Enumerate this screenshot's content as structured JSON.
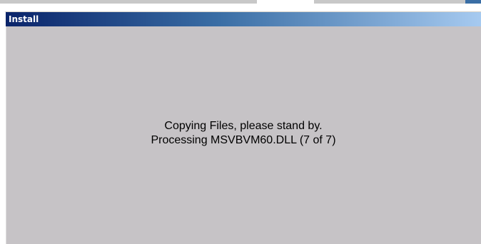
{
  "window": {
    "title": "Install"
  },
  "status": {
    "line1": "Copying Files, please stand by.",
    "line2": "Processing MSVBVM60.DLL (7 of 7)"
  },
  "colors": {
    "titlebar_start": "#0a246a",
    "titlebar_end": "#a6caf0",
    "window_background": "#c6c3c6",
    "title_text": "#ffffff",
    "body_text": "#000000"
  }
}
